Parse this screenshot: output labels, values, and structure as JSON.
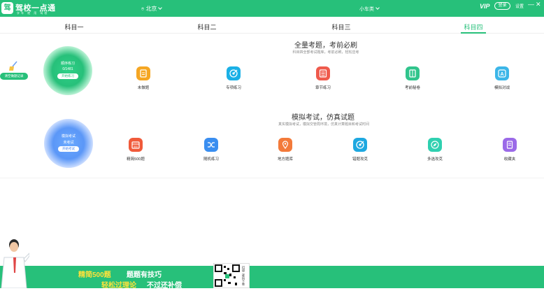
{
  "titlebar": {
    "app_name": "驾校一点通",
    "app_sub": "学车 就 用 驾校",
    "logo_glyph": "驾",
    "city": "北京",
    "car_type": "小车类",
    "vip": "VIP",
    "login": "登录",
    "settings": "设置",
    "min": "—",
    "close": "✕"
  },
  "tabs": [
    {
      "label": "科目一",
      "active": false
    },
    {
      "label": "科目二",
      "active": false
    },
    {
      "label": "科目三",
      "active": false
    },
    {
      "label": "科目四",
      "active": true
    }
  ],
  "section1": {
    "title": "全量考题，考前必刷",
    "subtitle": "科目四全部考试题库，考前必刷，轻松应考",
    "orb": {
      "t1": "顺序练习",
      "t2": "0/1481",
      "button": "开始练习"
    },
    "clear_label": "清空做题记录",
    "tiles": [
      {
        "label": "未做题",
        "color": "#f5a623",
        "icon": "file-icon"
      },
      {
        "label": "专项练习",
        "color": "#1ab0e6",
        "icon": "target-icon"
      },
      {
        "label": "章节练习",
        "color": "#ef5a4c",
        "icon": "list-icon"
      },
      {
        "label": "考前秘卷",
        "color": "#30c48c",
        "icon": "book-icon"
      },
      {
        "label": "模拟对战",
        "color": "#3cb6e8",
        "icon": "a-icon"
      }
    ]
  },
  "section2": {
    "title": "模拟考试，仿真试题",
    "subtitle": "真实模拟考试，模拟交管局环境，仿真计算题目和考试时间",
    "orb": {
      "t1": "模拟考试",
      "t2": "未考试",
      "button": "开始考试"
    },
    "tiles": [
      {
        "label": "精简500题",
        "color": "#f05a3a",
        "icon": "calendar-icon"
      },
      {
        "label": "随机练习",
        "color": "#3a8ef0",
        "icon": "shuffle-icon"
      },
      {
        "label": "地方题库",
        "color": "#f37a3a",
        "icon": "location-icon"
      },
      {
        "label": "错题攻克",
        "color": "#1ea8e0",
        "icon": "target-icon"
      },
      {
        "label": "多选攻克",
        "color": "#2fd0b0",
        "icon": "compass-icon"
      },
      {
        "label": "收藏夹",
        "color": "#9b6ae8",
        "icon": "bookmark-icon"
      }
    ]
  },
  "banner": {
    "line1_a": "精简500题",
    "line1_b": "题题有技巧",
    "line2_a": "轻松过理论",
    "line2_b": "不过还补偿",
    "qr_side": "扫描二维码下载"
  }
}
